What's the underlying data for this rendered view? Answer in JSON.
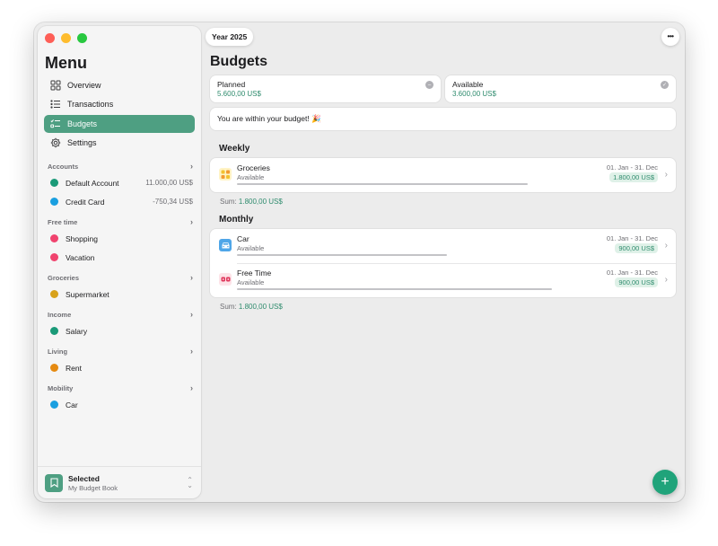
{
  "sidebar": {
    "title": "Menu",
    "nav": [
      {
        "label": "Overview",
        "icon": "grid-icon",
        "active": false
      },
      {
        "label": "Transactions",
        "icon": "list-icon",
        "active": false
      },
      {
        "label": "Budgets",
        "icon": "checklist-icon",
        "active": true
      },
      {
        "label": "Settings",
        "icon": "gear-icon",
        "active": false
      }
    ],
    "groups": [
      {
        "name": "Accounts",
        "items": [
          {
            "name": "Default Account",
            "amount": "11.000,00 US$",
            "color": "#1a9a78"
          },
          {
            "name": "Credit Card",
            "amount": "-750,34 US$",
            "color": "#1a9fe0"
          }
        ]
      },
      {
        "name": "Free time",
        "items": [
          {
            "name": "Shopping",
            "amount": "",
            "color": "#f0436e"
          },
          {
            "name": "Vacation",
            "amount": "",
            "color": "#f0436e"
          }
        ]
      },
      {
        "name": "Groceries",
        "items": [
          {
            "name": "Supermarket",
            "amount": "",
            "color": "#d8a21b"
          }
        ]
      },
      {
        "name": "Income",
        "items": [
          {
            "name": "Salary",
            "amount": "",
            "color": "#1a9a78"
          }
        ]
      },
      {
        "name": "Living",
        "items": [
          {
            "name": "Rent",
            "amount": "",
            "color": "#e58a12"
          }
        ]
      },
      {
        "name": "Mobility",
        "items": [
          {
            "name": "Car",
            "amount": "",
            "color": "#1a9fe0"
          }
        ]
      }
    ],
    "footer": {
      "title": "Selected",
      "subtitle": "My Budget Book"
    }
  },
  "header": {
    "year": "Year 2025",
    "more_label": "•••"
  },
  "main": {
    "title": "Budgets",
    "planned": {
      "label": "Planned",
      "value": "5.600,00 US$"
    },
    "available": {
      "label": "Available",
      "value": "3.600,00 US$"
    },
    "message": "You are within your budget! 🎉",
    "weekly": {
      "title": "Weekly",
      "items": [
        {
          "name": "Groceries",
          "status": "Available",
          "date": "01. Jan - 31. Dec",
          "amount": "1.800,00 US$",
          "progress": 0.91,
          "icon_bg": "#fff3c4",
          "icon_color": "#d8a21b"
        }
      ],
      "sum_label": "Sum:",
      "sum_value": "1.800,00 US$"
    },
    "monthly": {
      "title": "Monthly",
      "items": [
        {
          "name": "Car",
          "status": "Available",
          "date": "01. Jan - 31. Dec",
          "amount": "900,00 US$",
          "progress": 0.66,
          "icon_bg": "#4fa6e8",
          "icon_color": "#ffffff"
        },
        {
          "name": "Free Time",
          "status": "Available",
          "date": "01. Jan - 31. Dec",
          "amount": "900,00 US$",
          "progress": 1.0,
          "icon_bg": "#fde3e8",
          "icon_color": "#e0365b"
        }
      ],
      "sum_label": "Sum:",
      "sum_value": "1.800,00 US$"
    },
    "fab_label": "+"
  }
}
